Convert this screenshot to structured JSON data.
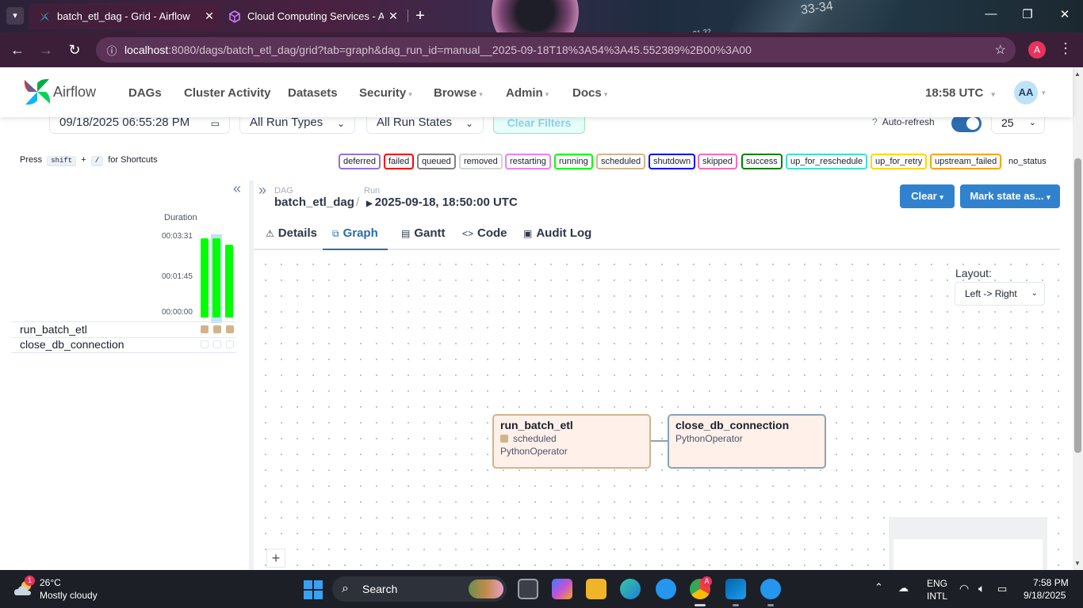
{
  "browser": {
    "tabs": [
      {
        "title": "batch_etl_dag - Grid - Airflow",
        "active": true
      },
      {
        "title": "Cloud Computing Services - Am",
        "active": false
      }
    ],
    "url_host": "localhost",
    "url_rest": ":8080/dags/batch_etl_dag/grid?tab=graph&dag_run_id=manual__2025-09-18T18%3A54%3A45.552389%2B00%3A00",
    "profile_initial": "A",
    "wallpaper_text_1": "33-34",
    "wallpaper_text_2": "31-32"
  },
  "nav": {
    "brand": "Airflow",
    "items": [
      "DAGs",
      "Cluster Activity",
      "Datasets",
      "Security",
      "Browse",
      "Admin",
      "Docs"
    ],
    "clock": "18:58 UTC",
    "avatar": "AA"
  },
  "filters": {
    "date": "09/18/2025 06:55:28 PM",
    "run_types": "All Run Types",
    "run_states": "All Run States",
    "clear_filters": "Clear Filters",
    "auto_refresh": "Auto-refresh",
    "page_size": "25"
  },
  "shortcuts": {
    "press": "Press",
    "key1": "shift",
    "plus": "+",
    "key2": "/",
    "suffix": "for Shortcuts"
  },
  "legend": [
    {
      "label": "deferred",
      "color": "#9370db"
    },
    {
      "label": "failed",
      "color": "#ff0000"
    },
    {
      "label": "queued",
      "color": "#808080"
    },
    {
      "label": "removed",
      "color": "#d3d3d3"
    },
    {
      "label": "restarting",
      "color": "#ee82ee"
    },
    {
      "label": "running",
      "color": "#00ff00"
    },
    {
      "label": "scheduled",
      "color": "#d2b48c"
    },
    {
      "label": "shutdown",
      "color": "#0000ff"
    },
    {
      "label": "skipped",
      "color": "#ff69b4"
    },
    {
      "label": "success",
      "color": "#008000"
    },
    {
      "label": "up_for_reschedule",
      "color": "#40e0d0"
    },
    {
      "label": "up_for_retry",
      "color": "#ffd700"
    },
    {
      "label": "upstream_failed",
      "color": "#ffa500"
    },
    {
      "label": "no_status",
      "color": "#ffffff"
    }
  ],
  "grid": {
    "duration_label": "Duration",
    "y_ticks": [
      "00:03:31",
      "00:01:45",
      "00:00:00"
    ],
    "runs": [
      {
        "duration_fraction": 1.0
      },
      {
        "duration_fraction": 1.0,
        "selected": true
      },
      {
        "duration_fraction": 0.92
      }
    ],
    "tasks": [
      "run_batch_etl",
      "close_db_connection"
    ]
  },
  "details": {
    "dag_label": "DAG",
    "dag_id": "batch_etl_dag",
    "run_label": "Run",
    "run_id": "2025-09-18, 18:50:00 UTC",
    "clear_button": "Clear",
    "mark_state_button": "Mark state as...",
    "tabs": [
      "Details",
      "Graph",
      "Gantt",
      "Code",
      "Audit Log"
    ],
    "selected_tab": "Graph"
  },
  "graph": {
    "layout_label": "Layout:",
    "layout_value": "Left -> Right",
    "nodes": [
      {
        "name": "run_batch_etl",
        "state": "scheduled",
        "operator": "PythonOperator",
        "border": "#d2b48c"
      },
      {
        "name": "close_db_connection",
        "state": "",
        "operator": "PythonOperator",
        "border": "#8aa3b8"
      }
    ]
  },
  "taskbar": {
    "weather_badge": "1",
    "temperature": "26°C",
    "condition": "Mostly cloudy",
    "search": "Search",
    "lang_1": "ENG",
    "lang_2": "INTL",
    "time": "7:58 PM",
    "date": "9/18/2025"
  }
}
